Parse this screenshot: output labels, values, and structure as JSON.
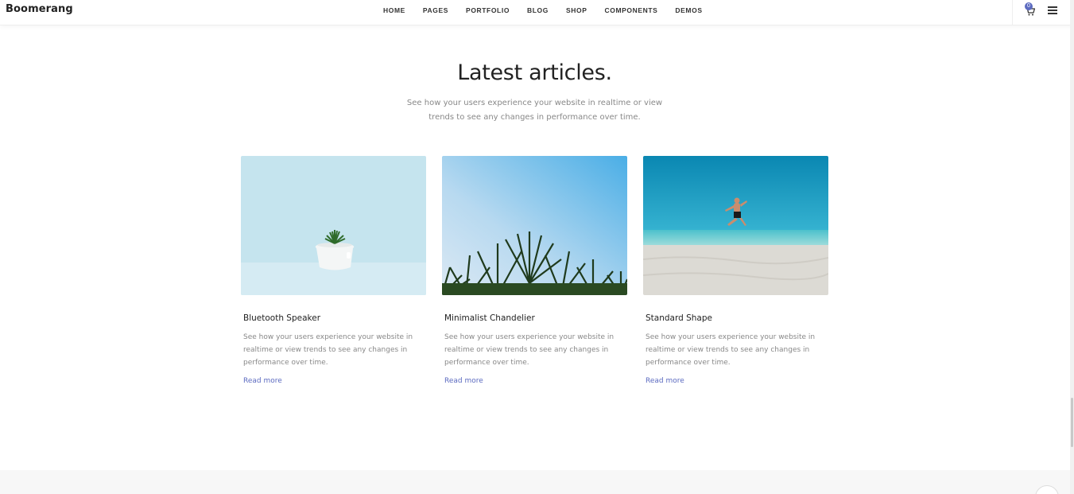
{
  "header": {
    "brand": "Boomerang",
    "nav": [
      "HOME",
      "PAGES",
      "PORTFOLIO",
      "BLOG",
      "SHOP",
      "COMPONENTS",
      "DEMOS"
    ],
    "cart_count": "0",
    "icons": {
      "cart": "cart-icon",
      "menu": "hamburger-menu-icon"
    }
  },
  "section": {
    "title": "Latest articles.",
    "subtitle_line1": "See how your users experience your website in realtime or view",
    "subtitle_line2": "trends to see any changes in performance over time."
  },
  "articles": [
    {
      "title": "Bluetooth Speaker",
      "text": "See how your users experience your website in realtime or view trends to see any changes in performance over time.",
      "link": "Read more"
    },
    {
      "title": "Minimalist Chandelier",
      "text": "See how your users experience your website in realtime or view trends to see any changes in performance over time.",
      "link": "Read more"
    },
    {
      "title": "Standard Shape",
      "text": "See how your users experience your website in realtime or view trends to see any changes in performance over time.",
      "link": "Read more"
    }
  ],
  "colors": {
    "accent": "#5c6bc0",
    "text_muted": "#888888",
    "footer_bg": "#f7f7f7"
  }
}
